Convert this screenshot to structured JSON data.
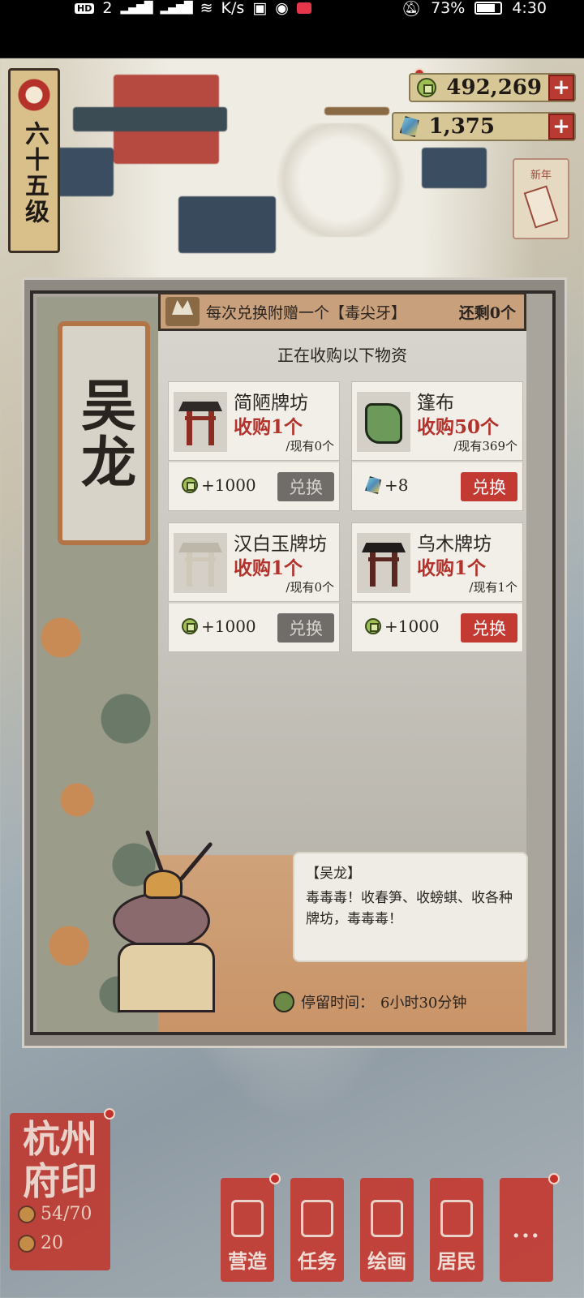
{
  "statusbar": {
    "hd_label": "HD",
    "sim_slot": "2",
    "net_speed_unit": "K/s",
    "battery": "73%",
    "time": "4:30"
  },
  "hud": {
    "level_label": "六十五级",
    "copper_coins": "492,269",
    "jade": "1,375",
    "plus_symbol": "+",
    "side_card_title": "新年"
  },
  "dialog": {
    "merchant_name": "吴龙",
    "banner_text": "每次兑换附赠一个【毒尖牙】",
    "banner_remaining": "还剩0个",
    "section_title": "正在收购以下物资",
    "items": [
      {
        "name": "简陋牌坊",
        "request": "收购1个",
        "have": "/现有0个",
        "reward": "+1000",
        "reward_type": "coin-icon",
        "button": "兑换",
        "button_state": "disabled"
      },
      {
        "name": "篷布",
        "request": "收购50个",
        "have": "/现有369个",
        "reward": "+8",
        "reward_type": "jade-icon",
        "button": "兑换",
        "button_state": "enabled"
      },
      {
        "name": "汉白玉牌坊",
        "request": "收购1个",
        "have": "/现有0个",
        "reward": "+1000",
        "reward_type": "coin-icon",
        "button": "兑换",
        "button_state": "disabled"
      },
      {
        "name": "乌木牌坊",
        "request": "收购1个",
        "have": "/现有1个",
        "reward": "+1000",
        "reward_type": "coin-icon",
        "button": "兑换",
        "button_state": "enabled"
      }
    ],
    "speech_speaker": "【吴龙】",
    "speech_text": "毒毒毒！收春笋、收螃蜞、收各种牌坊，毒毒毒！",
    "stay_label": "停留时间：",
    "stay_value": "6小时30分钟"
  },
  "bottom": {
    "seal_text_line1": "杭州",
    "seal_text_line2": "府印",
    "population": "54/70",
    "resource": "20",
    "menu": [
      {
        "label": "营造"
      },
      {
        "label": "任务"
      },
      {
        "label": "绘画"
      },
      {
        "label": "居民"
      },
      {
        "label": "..."
      }
    ]
  },
  "colors": {
    "accent_red": "#c33a32",
    "request_red": "#b3322b",
    "disabled_gray": "#6f6c6a",
    "paper": "#d9d6cf"
  }
}
